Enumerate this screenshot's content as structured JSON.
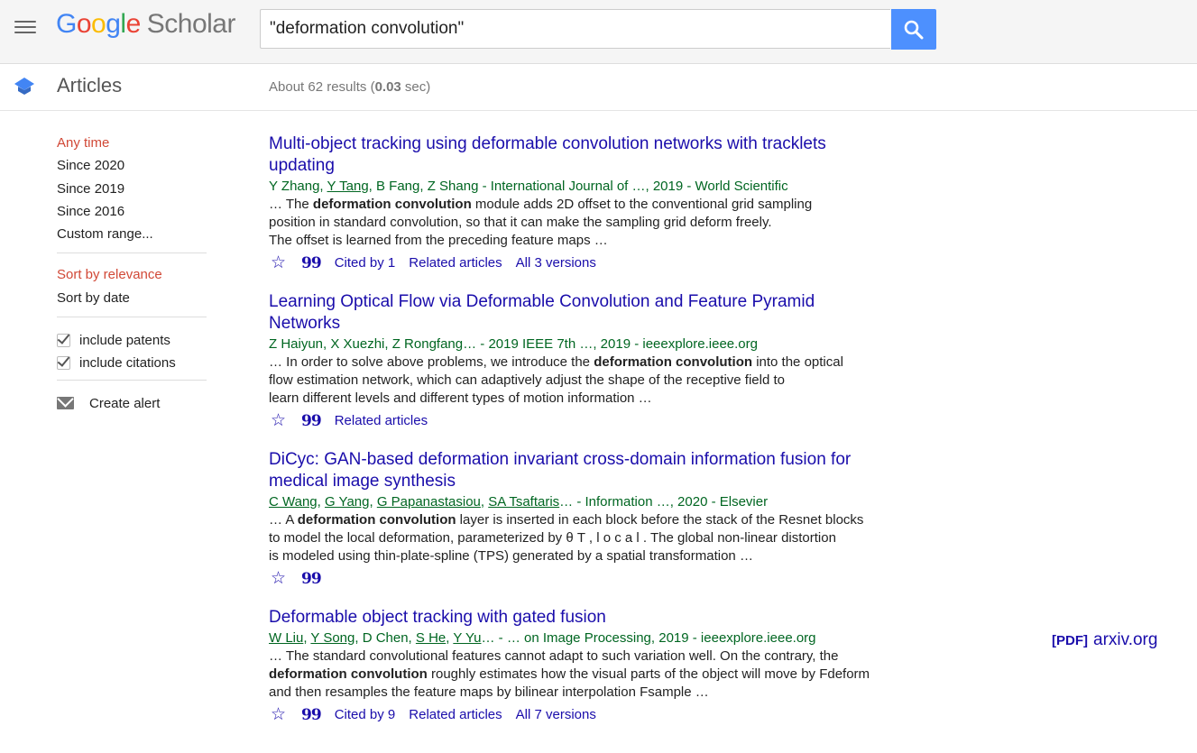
{
  "header": {
    "logo_google": [
      "G",
      "o",
      "o",
      "g",
      "l",
      "e"
    ],
    "logo_scholar": "Scholar",
    "search_value": "\"deformation convolution\""
  },
  "subheader": {
    "title": "Articles",
    "results_prefix": "About 62 results (",
    "results_time": "0.03",
    "results_suffix": " sec)"
  },
  "sidebar": {
    "time_filters": [
      "Any time",
      "Since 2020",
      "Since 2019",
      "Since 2016",
      "Custom range..."
    ],
    "sort_options": [
      "Sort by relevance",
      "Sort by date"
    ],
    "checks": [
      "include patents",
      "include citations"
    ],
    "create_alert": "Create alert"
  },
  "results": [
    {
      "title_l1": "Multi-object tracking using deformable convolution networks with tracklets",
      "title_l2": "updating",
      "meta": [
        {
          "t": "Y Zhang, "
        },
        {
          "t": "Y Tang",
          "u": true
        },
        {
          "t": ", B Fang, Z Shang - International Journal of …, 2019 - World Scientific"
        }
      ],
      "snippet": [
        {
          "t": "… The "
        },
        {
          "t": "deformation convolution",
          "b": true
        },
        {
          "t": " module adds 2D offset to the conventional grid sampling\nposition in standard convolution, so that it can make the sampling grid deform freely.\nThe offset is learned from the preceding feature maps …"
        }
      ],
      "actions": [
        "Cited by 1",
        "Related articles",
        "All 3 versions"
      ]
    },
    {
      "title_l1": "Learning Optical Flow via Deformable Convolution and Feature Pyramid",
      "title_l2": "Networks",
      "meta": [
        {
          "t": "Z Haiyun, X Xuezhi, Z Rongfang… - 2019 IEEE 7th …, 2019 - ieeexplore.ieee.org"
        }
      ],
      "snippet": [
        {
          "t": "… In order to solve above problems, we introduce the "
        },
        {
          "t": "deformation convolution",
          "b": true
        },
        {
          "t": " into the optical\nflow estimation network, which can adaptively adjust the shape of the receptive field to\nlearn different levels and different types of motion information …"
        }
      ],
      "actions": [
        "Related articles"
      ]
    },
    {
      "title_l1": "DiCyc: GAN-based deformation invariant cross-domain information fusion for",
      "title_l2": "medical image synthesis",
      "meta": [
        {
          "t": "C Wang",
          "u": true
        },
        {
          "t": ", "
        },
        {
          "t": "G Yang",
          "u": true
        },
        {
          "t": ", "
        },
        {
          "t": "G Papanastasiou",
          "u": true
        },
        {
          "t": ", "
        },
        {
          "t": "SA Tsaftaris",
          "u": true
        },
        {
          "t": "… - Information …, 2020 - Elsevier"
        }
      ],
      "snippet": [
        {
          "t": "… A "
        },
        {
          "t": "deformation convolution",
          "b": true
        },
        {
          "t": " layer is inserted in each block before the stack of the Resnet blocks\nto model the local deformation, parameterized by θ T , l o c a l . The global non-linear distortion\nis modeled using thin-plate-spline (TPS) generated by a spatial transformation …"
        }
      ],
      "actions": []
    },
    {
      "title_l1": "Deformable object tracking with gated fusion",
      "title_l2": "",
      "meta": [
        {
          "t": "W Liu",
          "u": true
        },
        {
          "t": ", "
        },
        {
          "t": "Y Song",
          "u": true
        },
        {
          "t": ", D Chen, "
        },
        {
          "t": "S He",
          "u": true
        },
        {
          "t": ", "
        },
        {
          "t": "Y Yu",
          "u": true
        },
        {
          "t": "… - … on Image Processing, 2019 - ieeexplore.ieee.org"
        }
      ],
      "snippet": [
        {
          "t": "… The standard convolutional features cannot adapt to such variation well. On the contrary, the\n"
        },
        {
          "t": "deformation convolution",
          "b": true
        },
        {
          "t": " roughly estimates how the visual parts of the object will move by Fdeform\nand then resamples the feature maps by bilinear interpolation Fsample …"
        }
      ],
      "actions": [
        "Cited by 9",
        "Related articles",
        "All 7 versions"
      ]
    }
  ],
  "pdf_link": {
    "tag": "[PDF]",
    "site": "arxiv.org"
  },
  "icons": {
    "star": "☆",
    "cite": "99"
  }
}
